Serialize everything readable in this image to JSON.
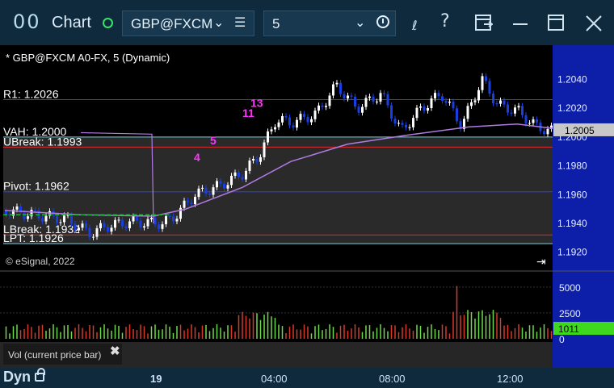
{
  "window": {
    "app_icon": "00",
    "title": "Chart",
    "symbol_value": "GBP@FXCM",
    "interval_value": "5",
    "toolbar_icons": [
      "draw-tool-icon",
      "help-icon",
      "page-layout-icon",
      "minimize-icon",
      "maximize-icon",
      "close-icon"
    ]
  },
  "chart": {
    "header": "* GBP@FXCM A0-FX, 5 (Dynamic)",
    "watermark": "© eSignal, 2022",
    "colors": {
      "up": "#ffffff",
      "down": "#1a3fe0",
      "pivot_line": "#2f3cff",
      "break_line": "#e02a2a",
      "avg_line": "#b07be0",
      "last_price_bg": "#c8c8c8"
    },
    "levels": [
      {
        "label": "R1: 1.2026",
        "price": 1.2026,
        "color": "#2f3cff"
      },
      {
        "label": "VAH: 1.2000",
        "price": 1.2,
        "color": "#6fd4e4"
      },
      {
        "label": "UBreak: 1.1993",
        "price": 1.1993,
        "color": "#e02a2a"
      },
      {
        "label": "Pivot: 1.1962",
        "price": 1.1962,
        "color": "#2f3cff"
      },
      {
        "label": "LBreak: 1.1932",
        "price": 1.1932,
        "color": "#e02a2a"
      },
      {
        "label": "LPT: 1.1926",
        "price": 1.1926,
        "color": "#6fd4e4"
      }
    ],
    "y_ticks": [
      "1.2040",
      "1.2020",
      "1.2000",
      "1.1980",
      "1.1960",
      "1.1940",
      "1.1920"
    ],
    "y_tick_values": [
      1.204,
      1.202,
      1.2,
      1.198,
      1.196,
      1.194,
      1.192
    ],
    "y_range": [
      1.1917,
      1.2061
    ],
    "last_price": "1.2005",
    "last_price_value": 1.2005,
    "seq_labels": [
      {
        "text": "13",
        "color": "#ff33ff"
      },
      {
        "text": "11",
        "color": "#ff33ff"
      },
      {
        "text": "4",
        "color": "#ff33ff"
      },
      {
        "text": "5",
        "color": "#ff33ff"
      }
    ]
  },
  "volume": {
    "label": "Vol (current price bar)",
    "close_symbol": "✖",
    "y_ticks": [
      "5000",
      "2500",
      "0"
    ],
    "y_tick_values": [
      5000,
      2500,
      0
    ],
    "last_value": "1011",
    "last_value_num": 1011
  },
  "time_axis": {
    "labels": [
      "19",
      "04:00",
      "08:00",
      "12:00"
    ],
    "mode": "Dyn"
  }
}
